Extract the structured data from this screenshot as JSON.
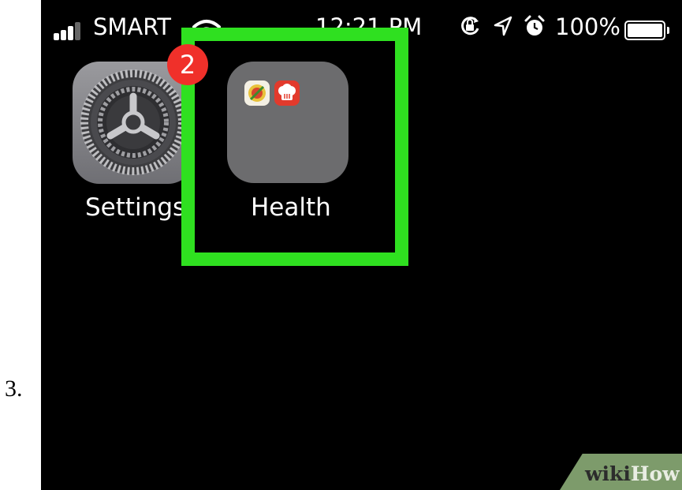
{
  "step": {
    "number": "3."
  },
  "status_bar": {
    "carrier": "SMART",
    "time": "12:21 PM",
    "battery_percent": "100%",
    "icons": [
      "signal-icon",
      "wifi-icon",
      "rotation-lock-icon",
      "location-icon",
      "alarm-icon",
      "battery-icon"
    ]
  },
  "home_screen": {
    "apps": [
      {
        "label": "Settings",
        "icon": "settings-gear-icon",
        "badge": "2"
      },
      {
        "label": "Health",
        "icon": "folder-icon",
        "contents": [
          "fitness-app-icon",
          "food-app-icon"
        ]
      }
    ]
  },
  "annotation": {
    "highlight_color": "#2fe020",
    "target": "Health"
  },
  "watermark": {
    "part1": "wiki",
    "part2": "How"
  }
}
